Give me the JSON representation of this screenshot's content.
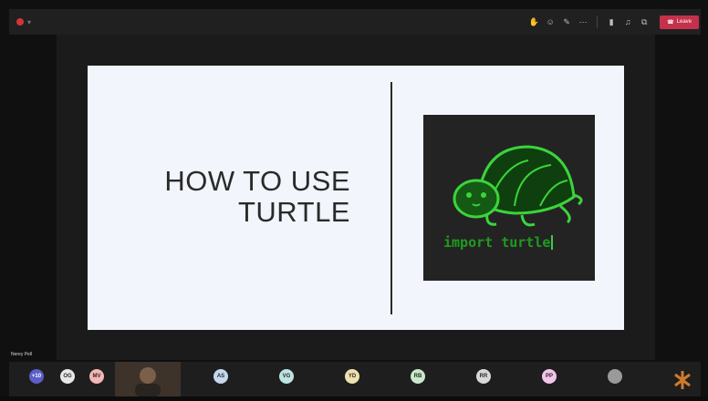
{
  "toolbar": {
    "icons": [
      "record-icon",
      "camera-icon",
      "chat-icon",
      "participants-icon",
      "more-icon",
      "video-icon",
      "mic-icon",
      "share-icon"
    ],
    "leave_label": "Leave"
  },
  "slide": {
    "title_line1": "HOW TO USE",
    "title_line2": "TURTLE",
    "code_text": "import turtle"
  },
  "presenter": {
    "name": "Nerey Pell"
  },
  "participants": [
    {
      "initials": "+10",
      "color": "#5b5fc7"
    },
    {
      "initials": "OG",
      "color": "#e8e8e8"
    },
    {
      "initials": "MV",
      "color": "#f5b6b6"
    },
    {
      "initials": "AS",
      "color": "#c5d7ee"
    },
    {
      "initials": "VG",
      "color": "#bfe3e3"
    },
    {
      "initials": "YD",
      "color": "#efe1b0"
    },
    {
      "initials": "RB",
      "color": "#c9e8c9"
    },
    {
      "initials": "RR",
      "color": "#d8d8d8"
    },
    {
      "initials": "PP",
      "color": "#f2c4e8"
    }
  ]
}
